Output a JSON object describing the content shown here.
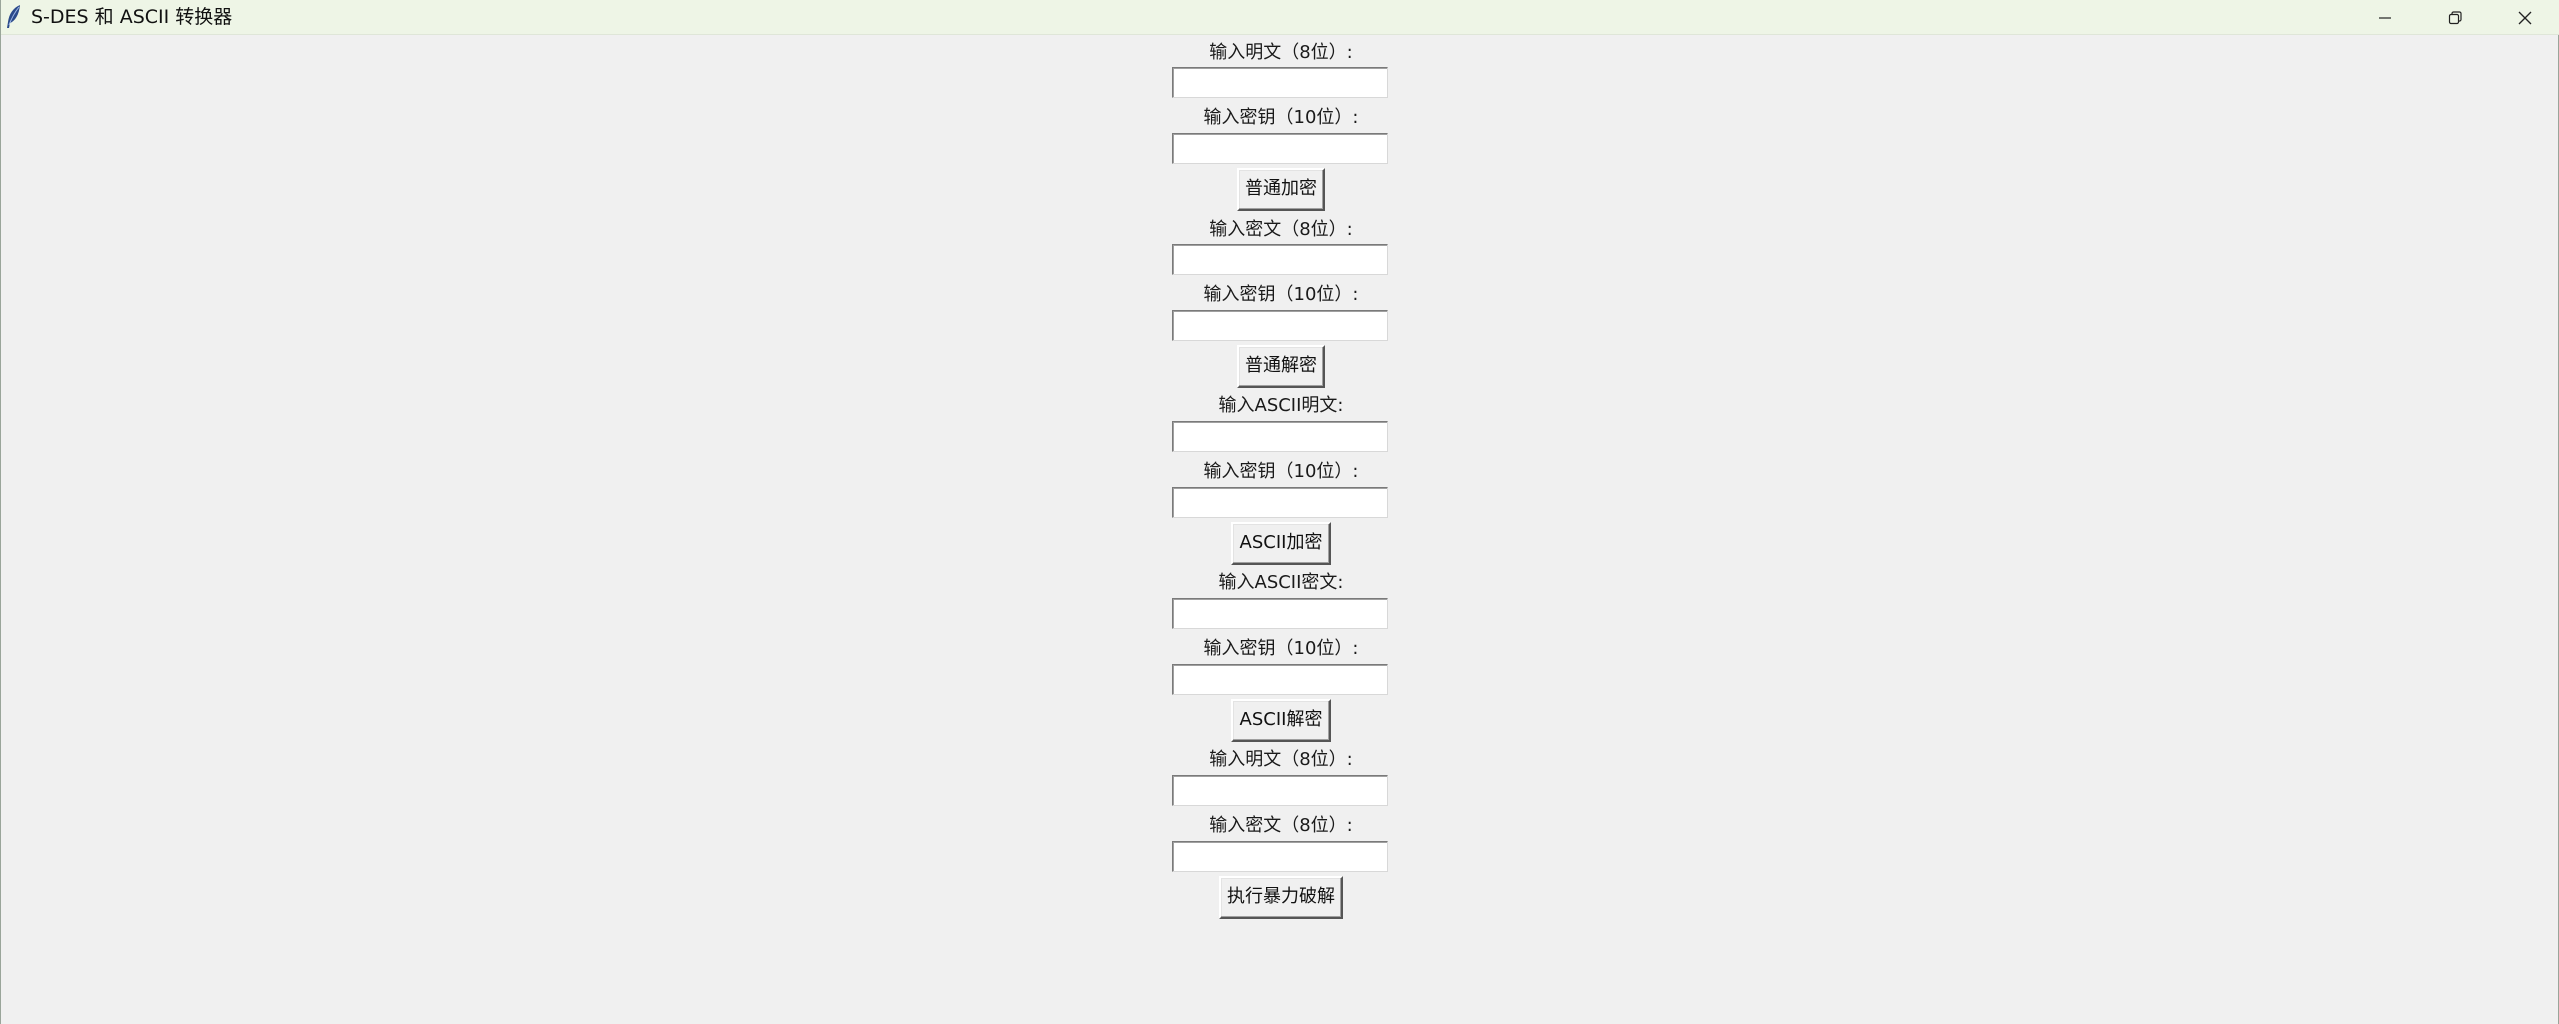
{
  "window": {
    "title": "S-DES 和 ASCII 转换器",
    "app_icon": "feather-icon",
    "controls": {
      "minimize_icon": "minimize-icon",
      "maximize_icon": "restore-icon",
      "close_icon": "close-icon"
    }
  },
  "form": {
    "encrypt": {
      "plaintext_label": "输入明文（8位）:",
      "key_label": "输入密钥（10位）:",
      "button": "普通加密"
    },
    "decrypt": {
      "ciphertext_label": "输入密文（8位）:",
      "key_label": "输入密钥（10位）:",
      "button": "普通解密"
    },
    "ascii_encrypt": {
      "plaintext_label": "输入ASCII明文:",
      "key_label": "输入密钥（10位）:",
      "button": "ASCII加密"
    },
    "ascii_decrypt": {
      "ciphertext_label": "输入ASCII密文:",
      "key_label": "输入密钥（10位）:",
      "button": "ASCII解密"
    },
    "brute_force": {
      "plaintext_label": "输入明文（8位）:",
      "ciphertext_label": "输入密文（8位）:",
      "button": "执行暴力破解"
    }
  }
}
